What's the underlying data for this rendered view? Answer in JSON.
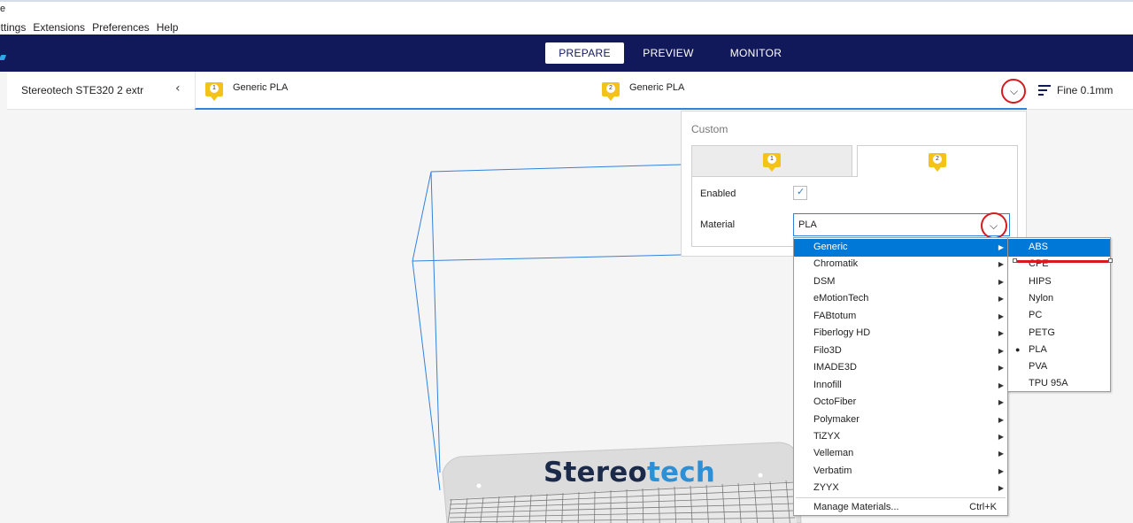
{
  "menubar": {
    "cut_title": "e",
    "items": [
      "ettings",
      "Extensions",
      "Preferences",
      "Help"
    ]
  },
  "stages": {
    "prepare": "PREPARE",
    "preview": "PREVIEW",
    "monitor": "MONITOR",
    "active": "PREPARE"
  },
  "printer": {
    "name": "Stereotech STE320 2 extr",
    "collapse_icon": "chevron-left-icon"
  },
  "extruders_bar": {
    "ext1": {
      "number": "1",
      "material": "Generic PLA"
    },
    "ext2": {
      "number": "2",
      "material": "Generic PLA"
    },
    "expand_icon": "chevron-down-icon"
  },
  "quality": {
    "label": "Fine 0.1mm",
    "icon": "print-settings-icon"
  },
  "extruder_popup": {
    "title": "Custom",
    "tab1_number": "1",
    "tab2_number": "2",
    "active_tab": "2",
    "enabled_label": "Enabled",
    "enabled_checked": true,
    "material_label": "Material",
    "material_value": "PLA"
  },
  "brand_menu": {
    "items": [
      {
        "label": "Generic",
        "highlighted": true
      },
      {
        "label": "Chromatik"
      },
      {
        "label": "DSM"
      },
      {
        "label": "eMotionTech"
      },
      {
        "label": "FABtotum"
      },
      {
        "label": "Fiberlogy HD"
      },
      {
        "label": "Filo3D"
      },
      {
        "label": "IMADE3D"
      },
      {
        "label": "Innofill"
      },
      {
        "label": "OctoFiber"
      },
      {
        "label": "Polymaker"
      },
      {
        "label": "TiZYX"
      },
      {
        "label": "Velleman"
      },
      {
        "label": "Verbatim"
      },
      {
        "label": "ZYYX"
      }
    ],
    "manage_label": "Manage Materials...",
    "manage_shortcut": "Ctrl+K"
  },
  "type_menu": {
    "items": [
      {
        "label": "ABS",
        "highlighted": true
      },
      {
        "label": "CPE"
      },
      {
        "label": "HIPS"
      },
      {
        "label": "Nylon"
      },
      {
        "label": "PC"
      },
      {
        "label": "PETG"
      },
      {
        "label": "PLA",
        "selected": true
      },
      {
        "label": "PVA"
      },
      {
        "label": "TPU 95A"
      }
    ]
  },
  "viewport": {
    "brand_text_main": "Stereo",
    "brand_text_accent": "tech"
  },
  "colors": {
    "header_bg": "#12195a",
    "accent_blue": "#3282dc",
    "highlight": "#0078d7",
    "badge_yellow": "#f3c31a",
    "annotation_red": "#d51b20"
  }
}
